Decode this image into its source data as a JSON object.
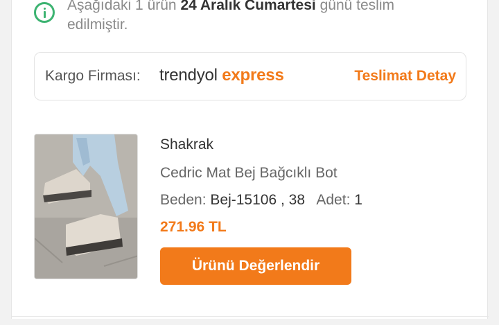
{
  "delivery": {
    "text_before": "Aşağıdaki 1 ürün ",
    "date": "24 Aralık Cumartesi",
    "text_after": " günü teslim edilmiştir."
  },
  "cargo": {
    "label": "Kargo Firması:",
    "brand_part1": "trendyol",
    "brand_part2": "express",
    "detail_link": "Teslimat Detay"
  },
  "product": {
    "seller": "Shakrak",
    "name": "Cedric Mat Bej Bağcıklı Bot",
    "size_label": "Beden:",
    "size_value": "Bej-15106 , 38",
    "qty_label": "Adet:",
    "qty_value": "1",
    "price": "271.96 TL",
    "review_button": "Ürünü Değerlendir"
  },
  "colors": {
    "accent": "#f27a1a",
    "success": "#3cb371"
  }
}
